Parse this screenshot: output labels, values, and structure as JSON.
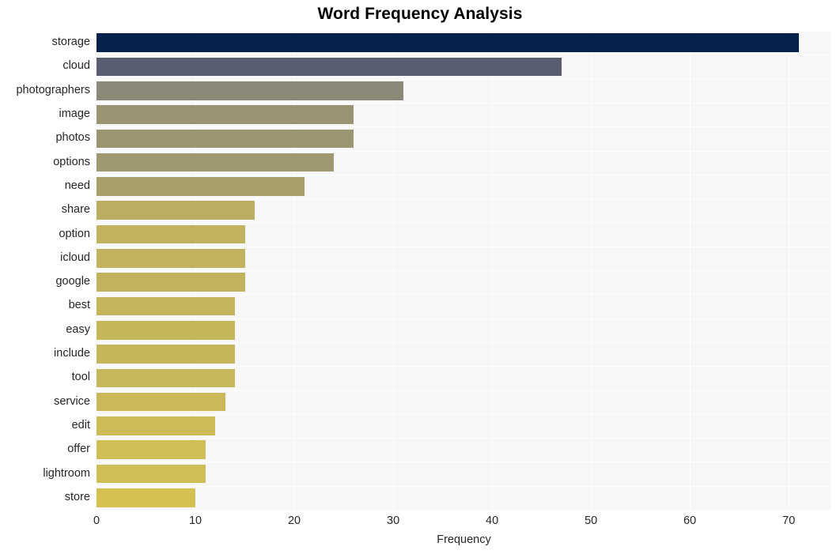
{
  "chart_data": {
    "type": "bar",
    "orientation": "horizontal",
    "title": "Word Frequency Analysis",
    "xlabel": "Frequency",
    "ylabel": "",
    "xlim": [
      0,
      74.3
    ],
    "xticks": [
      0,
      10,
      20,
      30,
      40,
      50,
      60,
      70
    ],
    "xtick_labels": [
      "0",
      "10",
      "20",
      "30",
      "40",
      "50",
      "60",
      "70"
    ],
    "grid": true,
    "legend": null,
    "categories": [
      "storage",
      "cloud",
      "photographers",
      "image",
      "photos",
      "options",
      "need",
      "share",
      "option",
      "icloud",
      "google",
      "best",
      "easy",
      "include",
      "tool",
      "service",
      "edit",
      "offer",
      "lightroom",
      "store"
    ],
    "values": [
      71,
      47,
      31,
      26,
      26,
      24,
      21,
      16,
      15,
      15,
      15,
      14,
      14,
      14,
      14,
      13,
      12,
      11,
      11,
      10
    ],
    "bar_colors": [
      "#04224c",
      "#585d70",
      "#8c8878",
      "#9a9472",
      "#9b9571",
      "#a09870",
      "#a79e6c",
      "#bbae61",
      "#c0b25e",
      "#c0b25e",
      "#c1b35e",
      "#c4b55c",
      "#c5b65b",
      "#c5b65b",
      "#c6b75b",
      "#c9b959",
      "#ccbb57",
      "#cfbd55",
      "#cfbd55",
      "#d4c152"
    ],
    "plot_background": "#f7f7f7",
    "gridline_color": "#ffffff",
    "text_color": "#262626"
  }
}
